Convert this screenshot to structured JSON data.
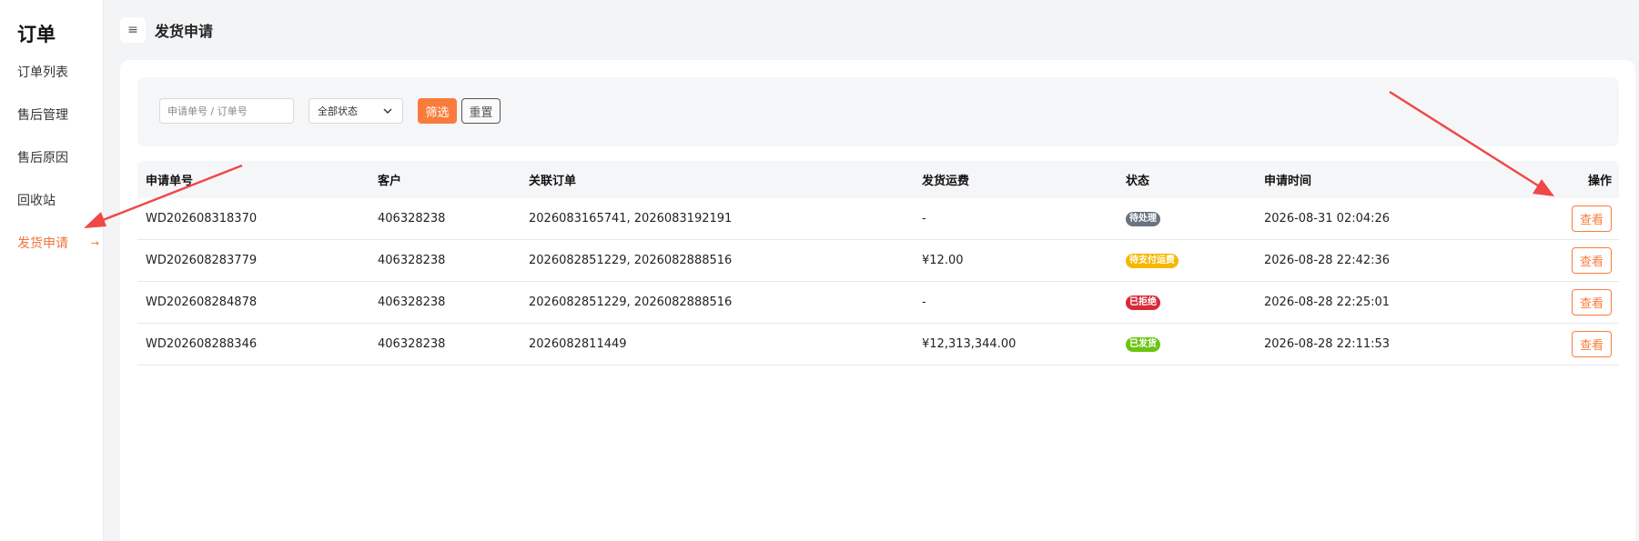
{
  "sidebar": {
    "title": "订单",
    "items": [
      {
        "label": "订单列表",
        "active": false
      },
      {
        "label": "售后管理",
        "active": false
      },
      {
        "label": "售后原因",
        "active": false
      },
      {
        "label": "回收站",
        "active": false
      },
      {
        "label": "发货申请",
        "active": true
      }
    ],
    "active_arrow": "→"
  },
  "header": {
    "menu_icon": "≡",
    "title": "发货申请"
  },
  "filter": {
    "search_placeholder": "申请单号 / 订单号",
    "status_value": "全部状态",
    "filter_label": "筛选",
    "reset_label": "重置"
  },
  "table": {
    "columns": [
      "申请单号",
      "客户",
      "关联订单",
      "发货运费",
      "状态",
      "申请时间",
      "操作"
    ],
    "rows": [
      {
        "id": "WD202608318370",
        "customer": "406328238",
        "orders": "2026083165741, 2026083192191",
        "fee": "-",
        "status": "待处理",
        "status_color": "#6b7280",
        "time": "2026-08-31 02:04:26",
        "action": "查看"
      },
      {
        "id": "WD202608283779",
        "customer": "406328238",
        "orders": "2026082851229, 2026082888516",
        "fee": "¥12.00",
        "status": "待支付运费",
        "status_color": "#f5b800",
        "time": "2026-08-28 22:42:36",
        "action": "查看"
      },
      {
        "id": "WD202608284878",
        "customer": "406328238",
        "orders": "2026082851229, 2026082888516",
        "fee": "-",
        "status": "已拒绝",
        "status_color": "#d62a3a",
        "time": "2026-08-28 22:25:01",
        "action": "查看"
      },
      {
        "id": "WD202608288346",
        "customer": "406328238",
        "orders": "2026082811449",
        "fee": "¥12,313,344.00",
        "status": "已发货",
        "status_color": "#6cc414",
        "time": "2026-08-28 22:11:53",
        "action": "查看"
      }
    ]
  },
  "accent_color": "#f97c3c",
  "annotation_color": "#f04848"
}
